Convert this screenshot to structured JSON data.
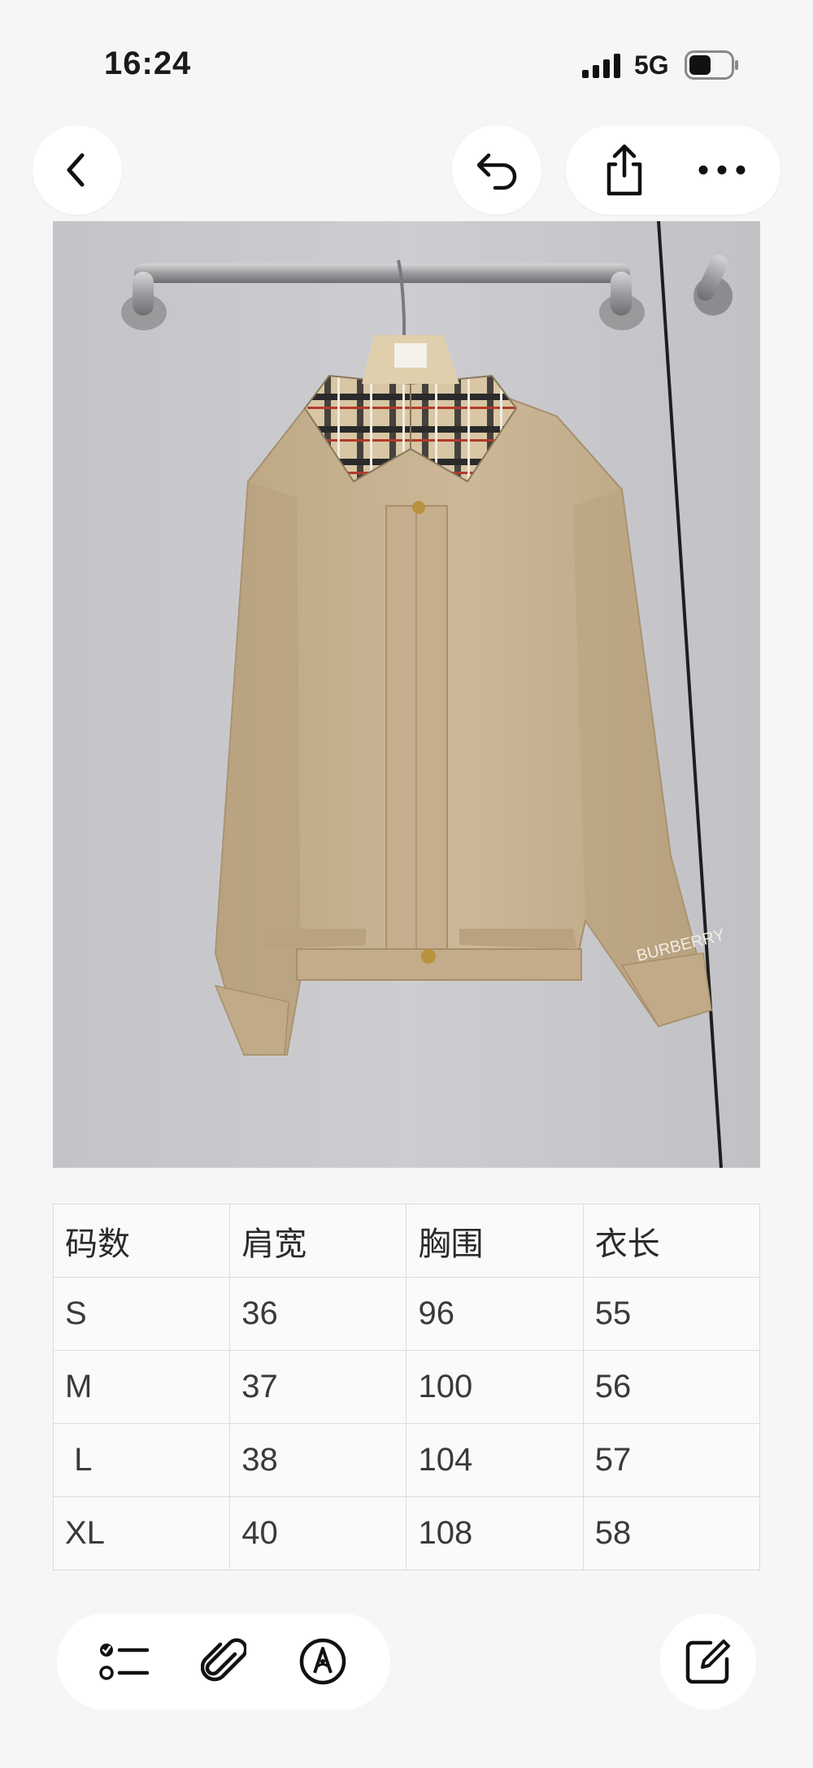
{
  "status_bar": {
    "time": "16:24",
    "network": "5G",
    "signal_icon": "cellular-signal-icon",
    "battery_icon": "battery-icon"
  },
  "nav": {
    "back_icon": "chevron-left-icon",
    "undo_icon": "undo-icon",
    "share_icon": "share-icon",
    "more_icon": "more-dots-icon"
  },
  "photo": {
    "subject": "beige jacket with checked collar on hanger",
    "label_text": "BURBERRY"
  },
  "size_table": {
    "headers": [
      "码数",
      "肩宽",
      "胸围",
      "衣长"
    ],
    "rows": [
      [
        "S",
        "36",
        "96",
        "55"
      ],
      [
        "M",
        "37",
        "100",
        "56"
      ],
      [
        " L",
        "38",
        "104",
        "57"
      ],
      [
        "XL",
        "40",
        "108",
        "58"
      ]
    ]
  },
  "toolbar": {
    "checklist_icon": "checklist-icon",
    "attach_icon": "paperclip-icon",
    "markup_icon": "pen-markup-icon",
    "compose_icon": "compose-icon"
  },
  "colors": {
    "background": "#f6f6f6",
    "jacket": "#c9b494",
    "wall": "#c6c6ca"
  }
}
